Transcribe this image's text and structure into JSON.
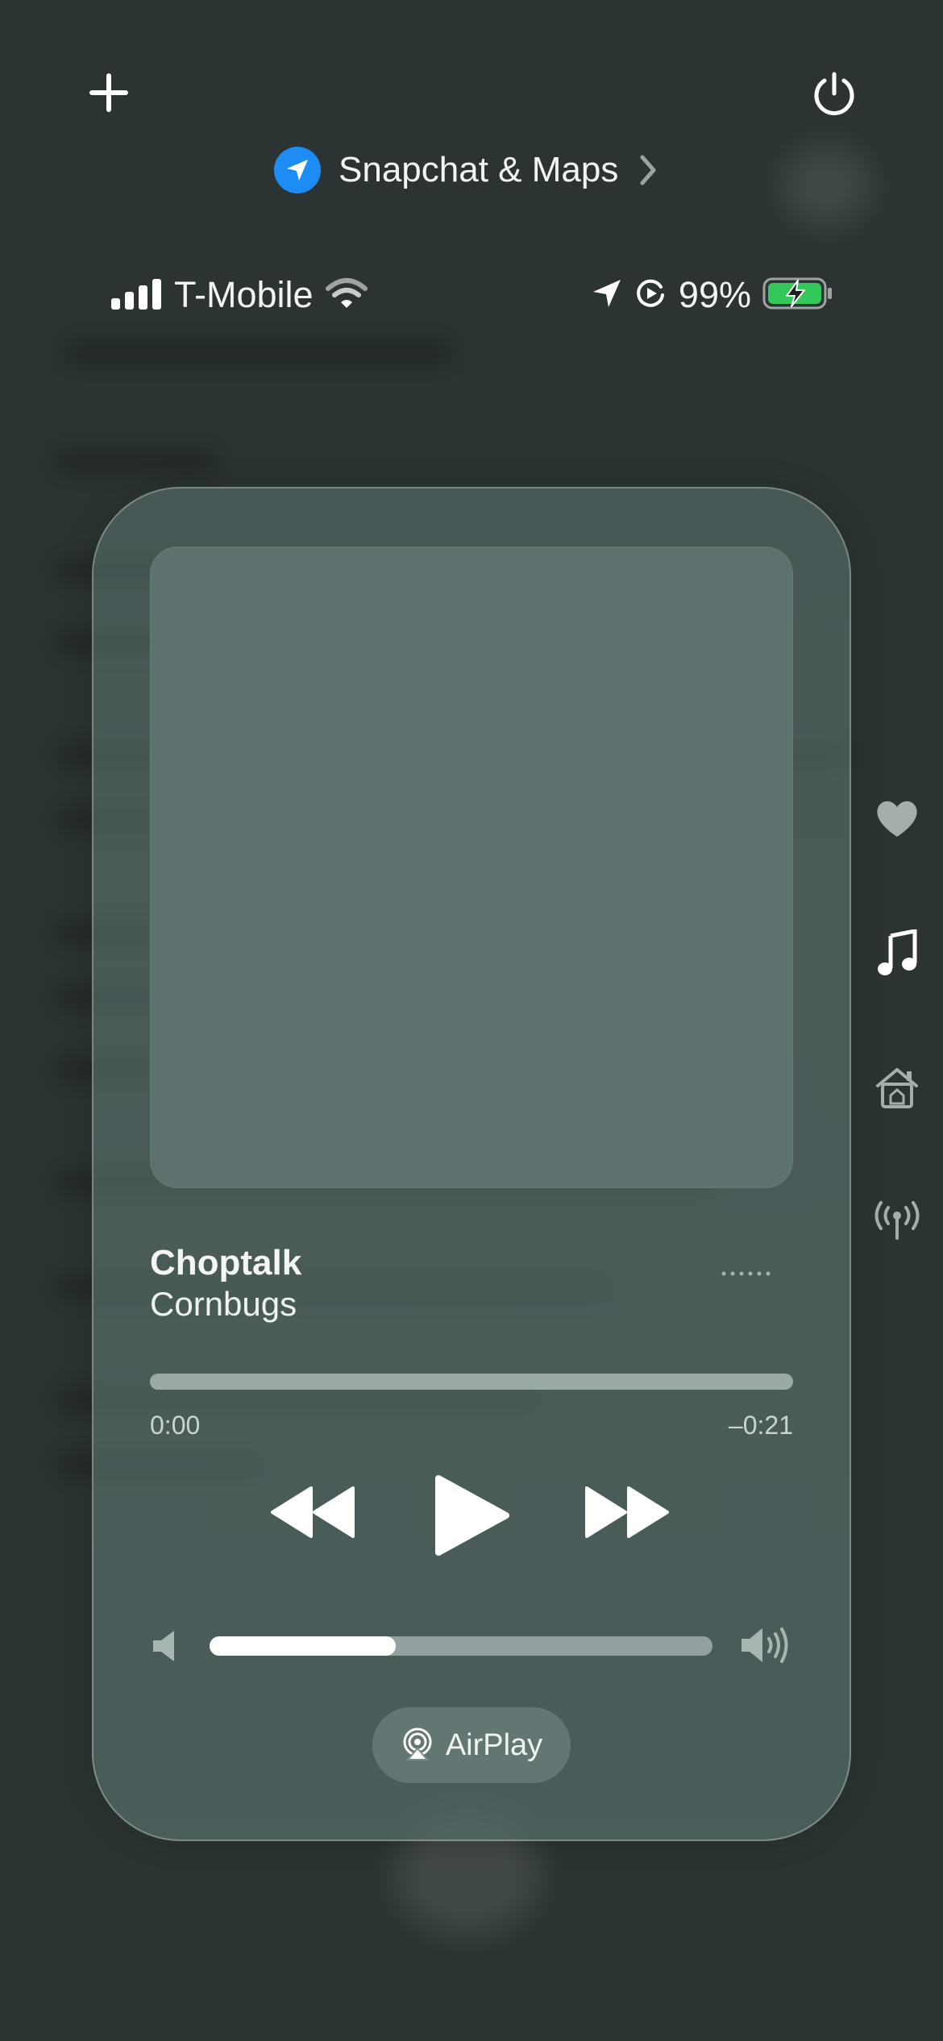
{
  "top": {
    "location_text": "Snapchat & Maps"
  },
  "status_bar": {
    "carrier": "T-Mobile",
    "battery_percent": "99%",
    "battery_color": "#34c759"
  },
  "side_icons": [
    "heart-icon",
    "music-note-icon",
    "home-icon",
    "antenna-icon"
  ],
  "player": {
    "title": "Choptalk",
    "artist": "Cornbugs",
    "elapsed": "0:00",
    "remaining": "–0:21",
    "progress_fraction": 0.0,
    "volume_fraction": 0.37,
    "airplay_label": "AirPlay"
  },
  "colors": {
    "accent_location": "#1e8cf5",
    "background": "#2b3433"
  }
}
